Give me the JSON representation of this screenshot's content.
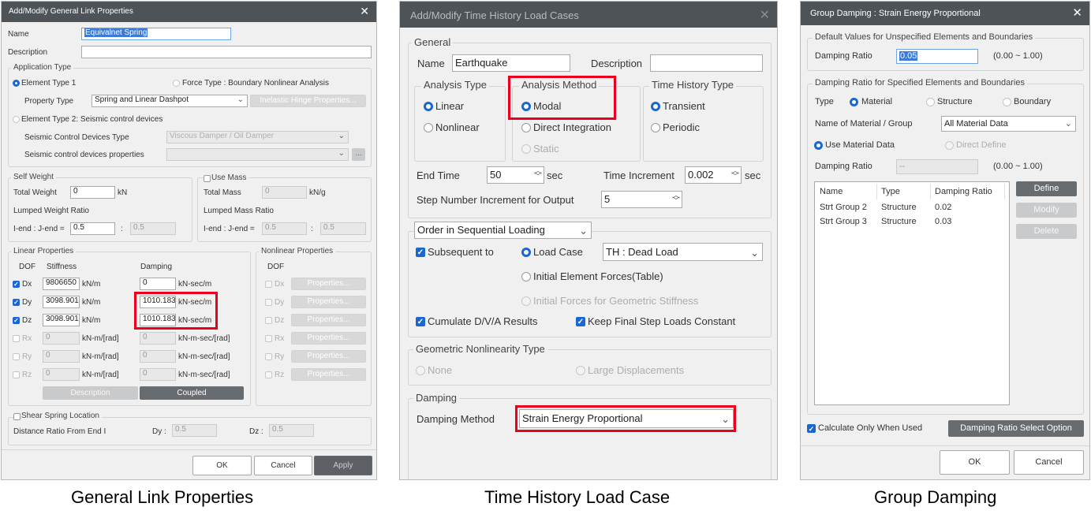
{
  "captions": [
    "General Link Properties",
    "Time History Load Case",
    "Group Damping"
  ],
  "link": {
    "title": "Add/Modify General Link Properties",
    "name_label": "Name",
    "name_value": "Equivalnet Spring",
    "desc_label": "Description",
    "app_type": "Application Type",
    "elem_type1": "Element Type 1",
    "force_type": "Force Type : Boundary Nonlinear Analysis",
    "property_type_label": "Property Type",
    "property_type_value": "Spring and Linear Dashpot",
    "inelastic_btn": "Inelastic Hinge Properties...",
    "elem_type2": "Element Type 2: Seismic control devices",
    "scd_type_label": "Seismic Control Devices Type",
    "scd_type_value": "Viscous Damper / Oil Damper",
    "scd_props_label": "Seismic control devices properties",
    "ellipsis": "...",
    "self_weight": "Self Weight",
    "total_weight": "Total Weight",
    "total_weight_value": "0",
    "kn": "kN",
    "lumped_weight": "Lumped Weight Ratio",
    "iend": "I-end : J-end =",
    "iend_value": "0.5",
    "colon": ":",
    "jend_value": "0.5",
    "use_mass": "Use Mass",
    "total_mass": "Total Mass",
    "total_mass_value": "0",
    "kng": "kN/g",
    "lumped_mass": "Lumped Mass Ratio",
    "mass_iend": "0.5",
    "mass_jend": "0.5",
    "linear": "Linear Properties",
    "dof": "DOF",
    "stiffness": "Stiffness",
    "damping": "Damping",
    "rows": [
      {
        "dof": "Dx",
        "checked": true,
        "k": "9806650",
        "ku": "kN/m",
        "c": "0",
        "cu": "kN-sec/m"
      },
      {
        "dof": "Dy",
        "checked": true,
        "k": "3098.901",
        "ku": "kN/m",
        "c": "1010.183",
        "cu": "kN-sec/m"
      },
      {
        "dof": "Dz",
        "checked": true,
        "k": "3098.901",
        "ku": "kN/m",
        "c": "1010.183",
        "cu": "kN-sec/m"
      },
      {
        "dof": "Rx",
        "checked": false,
        "k": "0",
        "ku": "kN-m/[rad]",
        "c": "0",
        "cu": "kN-m-sec/[rad]"
      },
      {
        "dof": "Ry",
        "checked": false,
        "k": "0",
        "ku": "kN-m/[rad]",
        "c": "0",
        "cu": "kN-m-sec/[rad]"
      },
      {
        "dof": "Rz",
        "checked": false,
        "k": "0",
        "ku": "kN-m/[rad]",
        "c": "0",
        "cu": "kN-m-sec/[rad]"
      }
    ],
    "description_btn": "Description",
    "coupled_btn": "Coupled",
    "nonlinear": "Nonlinear Properties",
    "properties_btn": "Properties...",
    "shear": "Shear Spring Location",
    "distance": "Distance Ratio From End I",
    "dy": "Dy :",
    "dy_value": "0.5",
    "dz": "Dz :",
    "dz_value": "0.5",
    "ok": "OK",
    "cancel": "Cancel",
    "apply": "Apply"
  },
  "th": {
    "title": "Add/Modify Time History Load Cases",
    "general": "General",
    "name_label": "Name",
    "name_value": "Earthquake",
    "desc_label": "Description",
    "analysis_type": "Analysis Type",
    "linear": "Linear",
    "nonlinear": "Nonlinear",
    "analysis_method": "Analysis Method",
    "modal": "Modal",
    "direct": "Direct Integration",
    "static": "Static",
    "th_type": "Time History Type",
    "transient": "Transient",
    "periodic": "Periodic",
    "end_time": "End Time",
    "end_time_value": "50",
    "sec": "sec",
    "time_inc": "Time Increment",
    "time_inc_value": "0.002",
    "step_label": "Step Number Increment for Output",
    "step_value": "5",
    "order": "Order in Sequential Loading",
    "subsequent": "Subsequent to",
    "load_case": "Load Case",
    "load_case_value": "TH : Dead Load",
    "initial_elem": "Initial Element Forces(Table)",
    "initial_geo": "Initial Forces for Geometric Stiffness",
    "cumulate": "Cumulate D/V/A Results",
    "keep": "Keep Final Step Loads Constant",
    "geo": "Geometric Nonlinearity Type",
    "none": "None",
    "large": "Large Displacements",
    "damping": "Damping",
    "damping_method": "Damping Method",
    "damping_method_value": "Strain Energy Proportional"
  },
  "gd": {
    "title": "Group Damping : Strain Energy Proportional",
    "default_group": "Default Values for Unspecified Elements and Boundaries",
    "damping_ratio": "Damping Ratio",
    "damping_ratio_value": "0.05",
    "range": "(0.00 ~ 1.00)",
    "specified_group": "Damping Ratio for Specified Elements and Boundaries",
    "type": "Type",
    "material": "Material",
    "structure": "Structure",
    "boundary": "Boundary",
    "name_label": "Name of Material / Group",
    "name_value": "All Material Data",
    "use_material": "Use Material Data",
    "direct_define": "Direct Define",
    "dr_value": "--",
    "col_name": "Name",
    "col_type": "Type",
    "col_ratio": "Damping Ratio",
    "items": [
      {
        "name": "Strt Group 2",
        "type": "Structure",
        "ratio": "0.02"
      },
      {
        "name": "Strt Group 3",
        "type": "Structure",
        "ratio": "0.03"
      }
    ],
    "define": "Define",
    "modify": "Modify",
    "delete": "Delete",
    "calc_only": "Calculate Only When Used",
    "select_option": "Damping Ratio Select Option",
    "ok": "OK",
    "cancel": "Cancel"
  }
}
